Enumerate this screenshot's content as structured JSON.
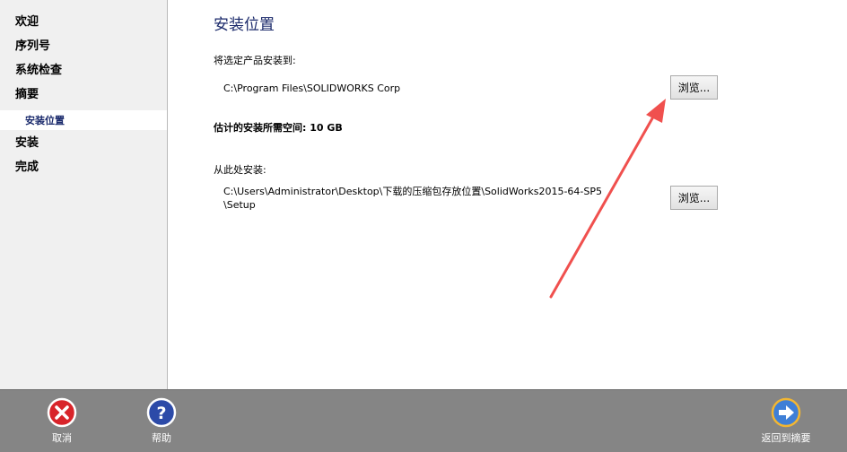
{
  "sidebar": {
    "items": [
      "欢迎",
      "序列号",
      "系统检查",
      "摘要"
    ],
    "sub_item": "安装位置",
    "items_after": [
      "安装",
      "完成"
    ]
  },
  "main": {
    "title": "安装位置",
    "install_to_label": "将选定产品安装到:",
    "install_path": "C:\\Program Files\\SOLIDWORKS Corp",
    "browse_label": "浏览...",
    "space_label": "估计的安装所需空间: 10 GB",
    "install_from_label": "从此处安装:",
    "source_path_line1": "C:\\Users\\Administrator\\Desktop\\下载的压缩包存放位置\\SolidWorks2015-64-SP5",
    "source_path_line2": "\\Setup"
  },
  "footer": {
    "cancel": "取消",
    "help": "帮助",
    "back": "返回到摘要"
  },
  "colors": {
    "accent": "#1b2a6b",
    "annotation_arrow": "#f0504e",
    "footer_bg": "#858585"
  },
  "icons": [
    "cancel-icon",
    "help-icon",
    "back-arrow-icon"
  ]
}
